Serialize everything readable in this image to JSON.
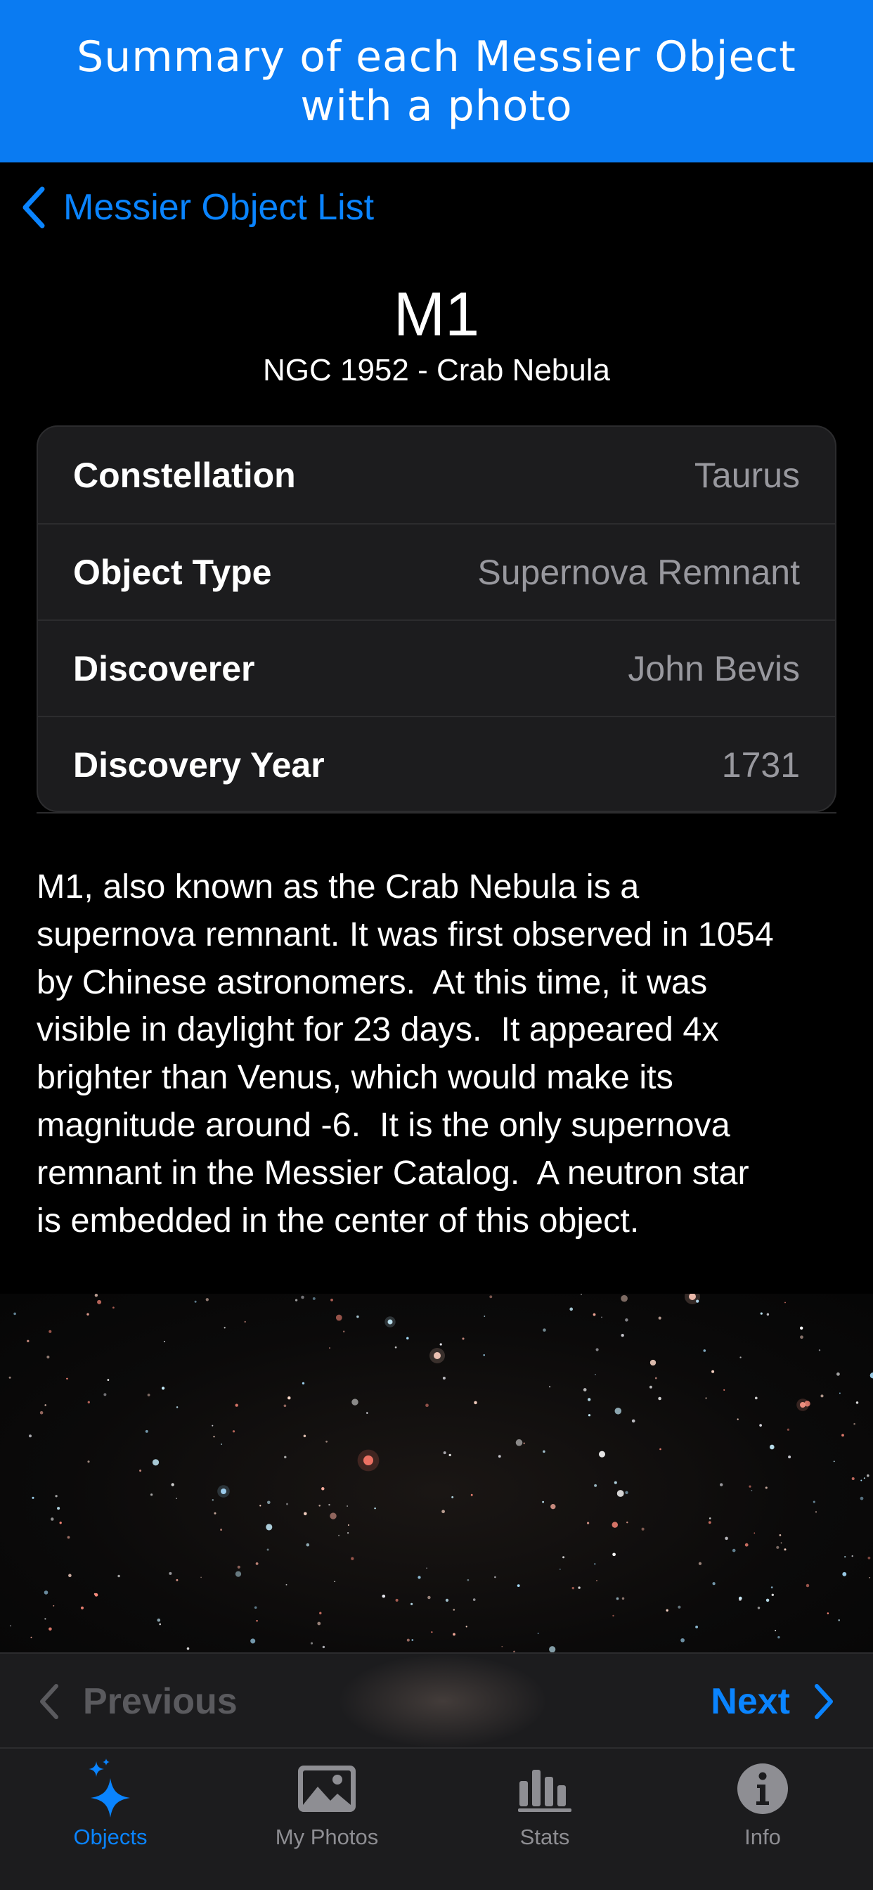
{
  "banner": {
    "line1": "Summary of each Messier Object",
    "line2": "with a photo"
  },
  "nav": {
    "back_label": "Messier Object List",
    "back_icon": "chevron-left-icon"
  },
  "object": {
    "title": "M1",
    "subtitle": "NGC 1952 - Crab Nebula"
  },
  "details": [
    {
      "label": "Constellation",
      "value": "Taurus"
    },
    {
      "label": "Object Type",
      "value": "Supernova Remnant"
    },
    {
      "label": "Discoverer",
      "value": "John Bevis"
    },
    {
      "label": "Discovery Year",
      "value": "1731"
    }
  ],
  "description_lines": [
    "M1, also known as the Crab Nebula is a",
    "supernova remnant. It was first observed in 1054",
    "by Chinese astronomers.  At this time, it was",
    "visible in daylight for 23 days.  It appeared 4x",
    "brighter than Venus, which would make its",
    "magnitude around -6.  It is the only supernova",
    "remnant in the Messier Catalog.  A neutron star",
    "is embedded in the center of this object."
  ],
  "pager": {
    "previous_label": "Previous",
    "next_label": "Next"
  },
  "tabs": [
    {
      "label": "Objects",
      "icon": "sparkles-icon",
      "active": true
    },
    {
      "label": "My Photos",
      "icon": "photo-icon",
      "active": false
    },
    {
      "label": "Stats",
      "icon": "bar-chart-icon",
      "active": false
    },
    {
      "label": "Info",
      "icon": "info-circle-icon",
      "active": false
    }
  ],
  "colors": {
    "banner": "#0a7bf2",
    "accent": "#0a84ff",
    "background": "#000000",
    "card": "#1c1c1e",
    "secondary_text": "#98989e",
    "disabled_text": "#5a5a5e",
    "inactive_tab": "#8e8e93"
  }
}
